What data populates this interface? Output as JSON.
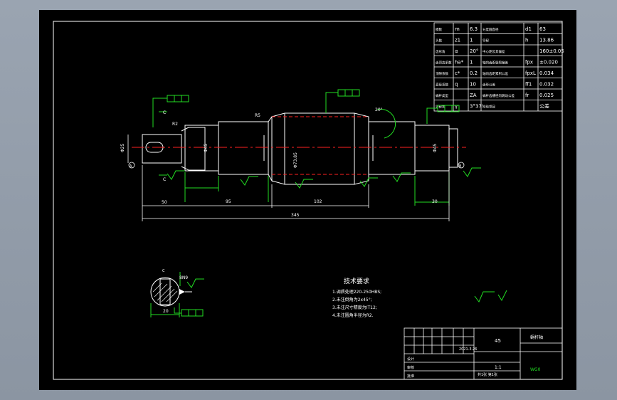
{
  "drawing": {
    "param_table": [
      [
        "模数",
        "m",
        "6.3",
        "分度圆直径",
        "d1",
        "63"
      ],
      [
        "头数",
        "z1",
        "1",
        "导程",
        "h",
        "13.86"
      ],
      [
        "齿形角",
        "α",
        "20°",
        "中心距及其偏差",
        "",
        "160±0.05"
      ],
      [
        "齿顶高系数",
        "ha*",
        "1",
        "轴向齿距极限偏差",
        "fpx",
        "±0.020"
      ],
      [
        "顶隙系数",
        "c*",
        "0.2",
        "轴向齿距累积公差",
        "fpxL",
        "0.034"
      ],
      [
        "直径系数",
        "q",
        "10",
        "齿形公差",
        "ff1",
        "0.032"
      ],
      [
        "蜗杆类型",
        "",
        "ZA",
        "蜗杆齿槽径向跳动公差",
        "fr",
        "0.025"
      ],
      [
        "导程角",
        "γ",
        "3°37'",
        "检验项目",
        "",
        "公差"
      ]
    ],
    "dimensions": {
      "overall": "345",
      "seg1": "50",
      "seg2": "95",
      "seg3": "102",
      "dia1": "Φ25",
      "dia2": "Φ45",
      "dia3": "Φ73.85",
      "dia4": "Φ45",
      "radius1": "R2",
      "radius2": "R5",
      "angle": "20°",
      "section_width": "20",
      "section_key": "8N9",
      "ref_a": "A",
      "ref_b": "B",
      "section_c": "C",
      "key_len": "30"
    },
    "tech_req": {
      "title": "技术要求",
      "items": [
        "1.调质处理220-250HBS;",
        "2.未注倒角为2x45°;",
        "3.未注尺寸精度为IT12;",
        "4.未注圆角半径为R2."
      ]
    },
    "title_block": {
      "part_name": "蜗杆轴",
      "scale": "1:1",
      "material": "45",
      "sheet": "共1张 第1张",
      "date": "2021.3.26",
      "drawing_no": "WG0",
      "label_design": "设计",
      "label_check": "审核",
      "label_approve": "批准"
    },
    "colors": {
      "background": "#000000",
      "line_white": "#ffffff",
      "dim_green": "#22dd22",
      "center_red": "#ff2020",
      "frame_grey": "#8f99a6"
    }
  }
}
